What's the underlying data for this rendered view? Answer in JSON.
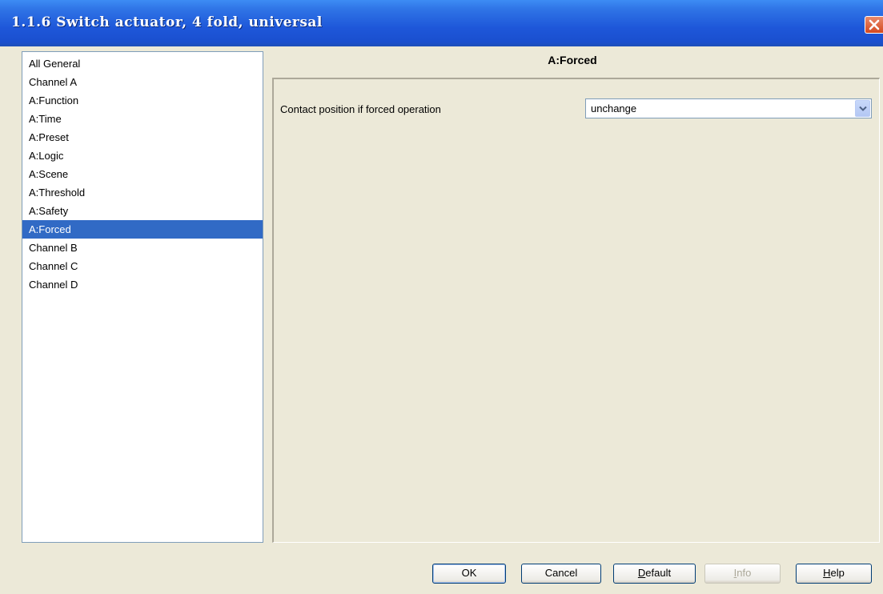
{
  "window": {
    "title": "1.1.6 Switch actuator, 4 fold, universal"
  },
  "nav": {
    "items": [
      {
        "label": "All General",
        "selected": false
      },
      {
        "label": "Channel A",
        "selected": false
      },
      {
        "label": "A:Function",
        "selected": false
      },
      {
        "label": "A:Time",
        "selected": false
      },
      {
        "label": "A:Preset",
        "selected": false
      },
      {
        "label": "A:Logic",
        "selected": false
      },
      {
        "label": "A:Scene",
        "selected": false
      },
      {
        "label": "A:Threshold",
        "selected": false
      },
      {
        "label": "A:Safety",
        "selected": false
      },
      {
        "label": "A:Forced",
        "selected": true
      },
      {
        "label": "Channel B",
        "selected": false
      },
      {
        "label": "Channel C",
        "selected": false
      },
      {
        "label": "Channel D",
        "selected": false
      }
    ]
  },
  "section": {
    "title": "A:Forced"
  },
  "params": {
    "contact_position": {
      "label": "Contact position if forced operation",
      "value": "unchange"
    }
  },
  "buttons": {
    "ok": {
      "prefix": "",
      "mnemonic": "",
      "rest": "OK"
    },
    "cancel": {
      "prefix": "",
      "mnemonic": "",
      "rest": "Cancel"
    },
    "default": {
      "prefix": "",
      "mnemonic": "D",
      "rest": "efault"
    },
    "info": {
      "prefix": "",
      "mnemonic": "I",
      "rest": "nfo"
    },
    "help": {
      "prefix": "",
      "mnemonic": "H",
      "rest": "elp"
    }
  },
  "icons": {
    "close": "close-icon",
    "dropdown": "chevron-down-icon"
  },
  "colors": {
    "titlebar": "#1e57d9",
    "selection": "#316ac5",
    "dialog_bg": "#ece9d8",
    "close": "#d4481e"
  }
}
